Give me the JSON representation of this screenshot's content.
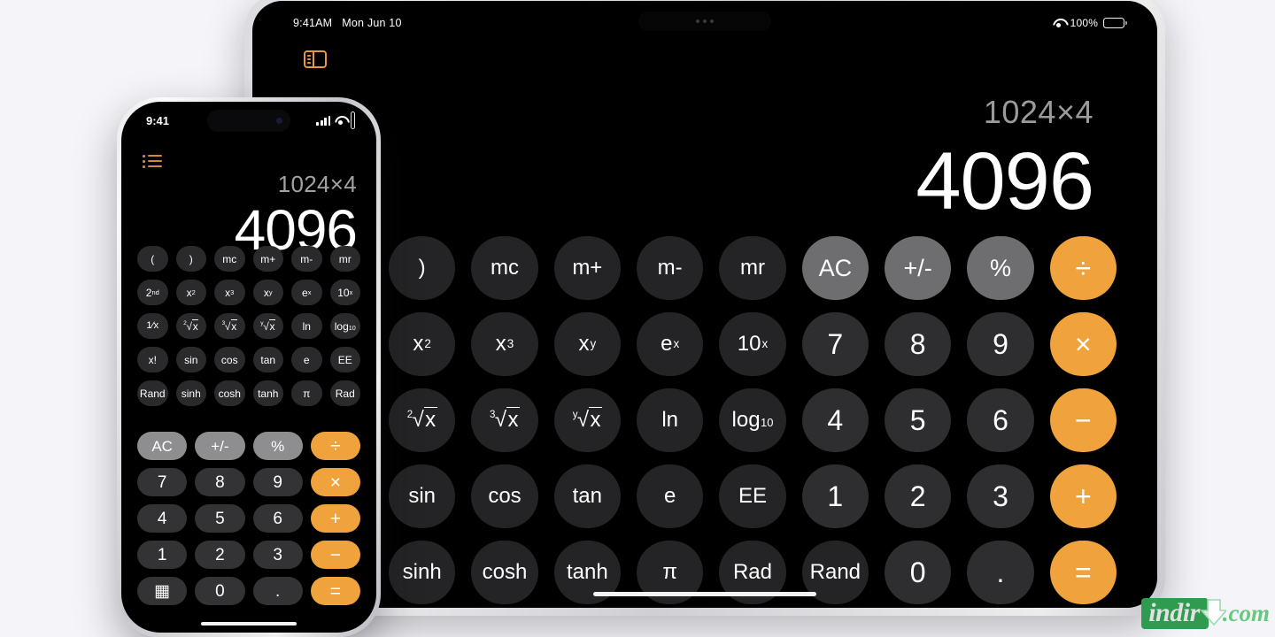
{
  "background_color": "#f5f4f8",
  "accent_color": "#f0a33c",
  "ipad": {
    "status": {
      "time": "9:41AM",
      "date": "Mon Jun 10",
      "wifi_label": "",
      "battery_percent": "100%"
    },
    "sidebar_icon": "sidebar-icon",
    "display": {
      "expression": "1024×4",
      "result": "4096"
    },
    "keypad_rows": [
      [
        {
          "label": ")",
          "type": "fn",
          "name": "key-close-paren"
        },
        {
          "label": "mc",
          "type": "fn",
          "name": "key-mc"
        },
        {
          "label": "m+",
          "type": "fn",
          "name": "key-m-plus"
        },
        {
          "label": "m-",
          "type": "fn",
          "name": "key-m-minus"
        },
        {
          "label": "mr",
          "type": "fn",
          "name": "key-mr"
        },
        {
          "label": "AC",
          "type": "util",
          "name": "key-ac"
        },
        {
          "label": "+/-",
          "type": "util",
          "name": "key-plus-minus"
        },
        {
          "label": "%",
          "type": "util",
          "name": "key-percent"
        },
        {
          "label": "÷",
          "type": "op",
          "name": "key-divide"
        }
      ],
      [
        {
          "label": "x²",
          "type": "fn",
          "name": "key-x-squared",
          "base": "x",
          "sup": "2"
        },
        {
          "label": "x³",
          "type": "fn",
          "name": "key-x-cubed",
          "base": "x",
          "sup": "3"
        },
        {
          "label": "xʸ",
          "type": "fn",
          "name": "key-x-to-y",
          "base": "x",
          "sup": "y"
        },
        {
          "label": "eˣ",
          "type": "fn",
          "name": "key-e-to-x",
          "base": "e",
          "sup": "x"
        },
        {
          "label": "10ˣ",
          "type": "fn",
          "name": "key-ten-to-x",
          "base": "10",
          "sup": "x"
        },
        {
          "label": "7",
          "type": "num",
          "name": "key-7"
        },
        {
          "label": "8",
          "type": "num",
          "name": "key-8"
        },
        {
          "label": "9",
          "type": "num",
          "name": "key-9"
        },
        {
          "label": "×",
          "type": "op",
          "name": "key-multiply"
        }
      ],
      [
        {
          "label": "²√x",
          "type": "fn",
          "name": "key-square-root",
          "radical": "2"
        },
        {
          "label": "³√x",
          "type": "fn",
          "name": "key-cube-root",
          "radical": "3"
        },
        {
          "label": "ʸ√x",
          "type": "fn",
          "name": "key-y-root",
          "radical": "y"
        },
        {
          "label": "ln",
          "type": "fn",
          "name": "key-ln"
        },
        {
          "label": "log₁₀",
          "type": "fn",
          "name": "key-log10",
          "base": "log",
          "sub": "10"
        },
        {
          "label": "4",
          "type": "num",
          "name": "key-4"
        },
        {
          "label": "5",
          "type": "num",
          "name": "key-5"
        },
        {
          "label": "6",
          "type": "num",
          "name": "key-6"
        },
        {
          "label": "−",
          "type": "op",
          "name": "key-subtract"
        }
      ],
      [
        {
          "label": "sin",
          "type": "fn",
          "name": "key-sin"
        },
        {
          "label": "cos",
          "type": "fn",
          "name": "key-cos"
        },
        {
          "label": "tan",
          "type": "fn",
          "name": "key-tan"
        },
        {
          "label": "e",
          "type": "fn",
          "name": "key-e"
        },
        {
          "label": "EE",
          "type": "fn",
          "name": "key-ee"
        },
        {
          "label": "1",
          "type": "num",
          "name": "key-1"
        },
        {
          "label": "2",
          "type": "num",
          "name": "key-2"
        },
        {
          "label": "3",
          "type": "num",
          "name": "key-3"
        },
        {
          "label": "+",
          "type": "op",
          "name": "key-add"
        }
      ],
      [
        {
          "label": "sinh",
          "type": "fn",
          "name": "key-sinh"
        },
        {
          "label": "cosh",
          "type": "fn",
          "name": "key-cosh"
        },
        {
          "label": "tanh",
          "type": "fn",
          "name": "key-tanh"
        },
        {
          "label": "π",
          "type": "fn",
          "name": "key-pi"
        },
        {
          "label": "Rad",
          "type": "fn",
          "name": "key-rad"
        },
        {
          "label": "Rand",
          "type": "fn",
          "name": "key-rand"
        },
        {
          "label": "0",
          "type": "num",
          "name": "key-0"
        },
        {
          "label": ".",
          "type": "num",
          "name": "key-decimal"
        },
        {
          "label": "=",
          "type": "op",
          "name": "key-equals"
        }
      ]
    ]
  },
  "iphone": {
    "status": {
      "time": "9:41"
    },
    "list_icon": "list-icon",
    "display": {
      "expression": "1024×4",
      "result": "4096"
    },
    "sci_rows": [
      [
        {
          "label": "(",
          "name": "key-open-paren"
        },
        {
          "label": ")",
          "name": "key-close-paren"
        },
        {
          "label": "mc",
          "name": "key-mc"
        },
        {
          "label": "m+",
          "name": "key-m-plus"
        },
        {
          "label": "m-",
          "name": "key-m-minus"
        },
        {
          "label": "mr",
          "name": "key-mr"
        }
      ],
      [
        {
          "label": "2nd",
          "name": "key-2nd",
          "base": "2",
          "sup": "nd"
        },
        {
          "label": "x²",
          "name": "key-x-squared",
          "base": "x",
          "sup": "2"
        },
        {
          "label": "x³",
          "name": "key-x-cubed",
          "base": "x",
          "sup": "3"
        },
        {
          "label": "xʸ",
          "name": "key-x-to-y",
          "base": "x",
          "sup": "y"
        },
        {
          "label": "eˣ",
          "name": "key-e-to-x",
          "base": "e",
          "sup": "x"
        },
        {
          "label": "10ˣ",
          "name": "key-ten-to-x",
          "base": "10",
          "sup": "x"
        }
      ],
      [
        {
          "label": "1/x",
          "name": "key-reciprocal",
          "frac": true
        },
        {
          "label": "²√x",
          "name": "key-square-root",
          "radical": "2"
        },
        {
          "label": "³√x",
          "name": "key-cube-root",
          "radical": "3"
        },
        {
          "label": "ʸ√x",
          "name": "key-y-root",
          "radical": "y"
        },
        {
          "label": "ln",
          "name": "key-ln"
        },
        {
          "label": "log₁₀",
          "name": "key-log10",
          "base": "log",
          "sub": "10"
        }
      ],
      [
        {
          "label": "x!",
          "name": "key-factorial"
        },
        {
          "label": "sin",
          "name": "key-sin"
        },
        {
          "label": "cos",
          "name": "key-cos"
        },
        {
          "label": "tan",
          "name": "key-tan"
        },
        {
          "label": "e",
          "name": "key-e"
        },
        {
          "label": "EE",
          "name": "key-ee"
        }
      ],
      [
        {
          "label": "Rand",
          "name": "key-rand"
        },
        {
          "label": "sinh",
          "name": "key-sinh"
        },
        {
          "label": "cosh",
          "name": "key-cosh"
        },
        {
          "label": "tanh",
          "name": "key-tanh"
        },
        {
          "label": "π",
          "name": "key-pi"
        },
        {
          "label": "Rad",
          "name": "key-rad"
        }
      ]
    ],
    "main_rows": [
      [
        {
          "label": "AC",
          "type": "util",
          "name": "key-ac"
        },
        {
          "label": "+/-",
          "type": "util",
          "name": "key-plus-minus"
        },
        {
          "label": "%",
          "type": "util",
          "name": "key-percent"
        },
        {
          "label": "÷",
          "type": "op",
          "name": "key-divide"
        }
      ],
      [
        {
          "label": "7",
          "type": "num",
          "name": "key-7"
        },
        {
          "label": "8",
          "type": "num",
          "name": "key-8"
        },
        {
          "label": "9",
          "type": "num",
          "name": "key-9"
        },
        {
          "label": "×",
          "type": "op",
          "name": "key-multiply"
        }
      ],
      [
        {
          "label": "4",
          "type": "num",
          "name": "key-4"
        },
        {
          "label": "5",
          "type": "num",
          "name": "key-5"
        },
        {
          "label": "6",
          "type": "num",
          "name": "key-6"
        },
        {
          "label": "+",
          "type": "op",
          "name": "key-add"
        }
      ],
      [
        {
          "label": "1",
          "type": "num",
          "name": "key-1"
        },
        {
          "label": "2",
          "type": "num",
          "name": "key-2"
        },
        {
          "label": "3",
          "type": "num",
          "name": "key-3"
        },
        {
          "label": "−",
          "type": "op",
          "name": "key-subtract"
        }
      ],
      [
        {
          "label": "▦",
          "type": "num",
          "name": "key-calculator-mode"
        },
        {
          "label": "0",
          "type": "num",
          "name": "key-0"
        },
        {
          "label": ".",
          "type": "num",
          "name": "key-decimal"
        },
        {
          "label": "=",
          "type": "op",
          "name": "key-equals"
        }
      ]
    ]
  },
  "watermark": {
    "brand": "indir",
    "suffix": ".com",
    "box_color": "#2e9b4f",
    "suffix_color": "#67c97f"
  }
}
